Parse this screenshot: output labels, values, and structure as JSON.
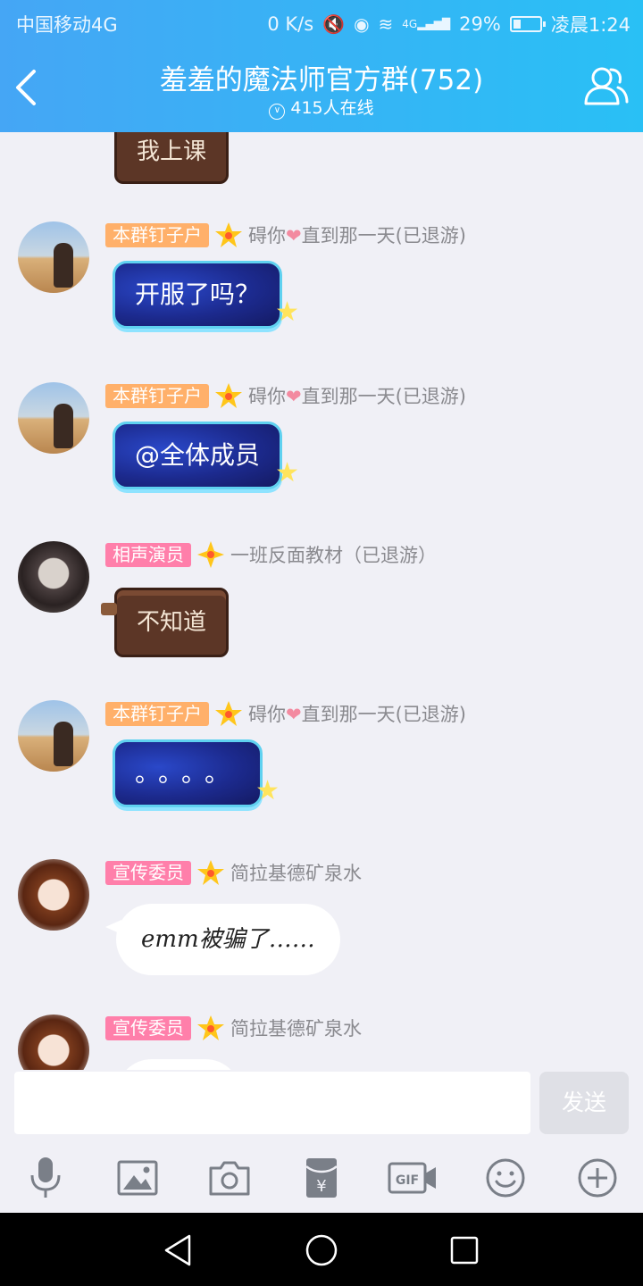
{
  "status_bar": {
    "carrier": "中国移动4G",
    "speed": "0 K/s",
    "network": "4G",
    "battery": "29%",
    "time": "凌晨1:24"
  },
  "header": {
    "title": "羞羞的魔法师官方群(752)",
    "online": "415人在线"
  },
  "messages": [
    {
      "text": "我上课"
    },
    {
      "badge": "本群钉子户",
      "nick_pre": "碍你",
      "nick_post": "直到那一天(已退游)",
      "text": "开服了吗？"
    },
    {
      "badge": "本群钉子户",
      "nick_pre": "碍你",
      "nick_post": "直到那一天(已退游)",
      "text": "@全体成员"
    },
    {
      "badge": "相声演员",
      "nick": "一班反面教材（已退游）",
      "text": "不知道"
    },
    {
      "badge": "本群钉子户",
      "nick_pre": "碍你",
      "nick_post": "直到那一天(已退游)",
      "text": "。。。。"
    },
    {
      "badge": "宣传委员",
      "nick": "简拉基德矿泉水",
      "text": "emm被骗了……"
    },
    {
      "badge": "宣传委员",
      "nick": "简拉基德矿泉水"
    }
  ],
  "input": {
    "value": "",
    "placeholder": ""
  },
  "send_label": "发送",
  "toolbar_icons": [
    "microphone-icon",
    "image-icon",
    "camera-icon",
    "red-packet-icon",
    "gif-icon",
    "emoji-icon",
    "plus-icon"
  ],
  "nav_icons": [
    "back-triangle-icon",
    "home-circle-icon",
    "recents-square-icon"
  ],
  "colors": {
    "header_start": "#45a6f5",
    "header_end": "#29c0f5",
    "badge_orange": "#ffb06a",
    "badge_pink": "#ff7faa"
  }
}
